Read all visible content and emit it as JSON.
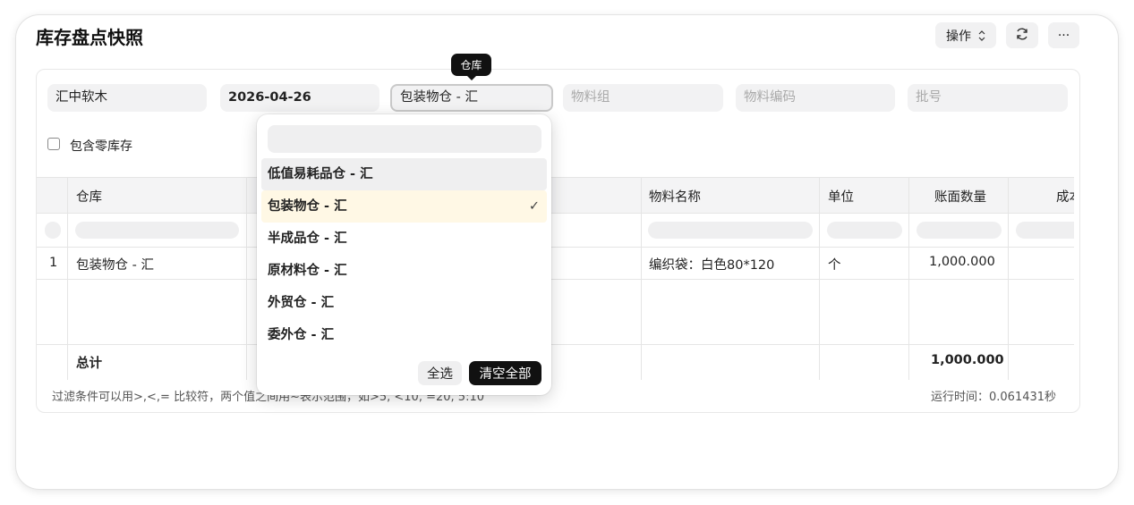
{
  "page": {
    "title": "库存盘点快照"
  },
  "toolbar": {
    "actions_label": "操作",
    "actions_chevron": "⌃⌄",
    "refresh_icon": "refresh-icon",
    "more_label": "···"
  },
  "filters": {
    "company": "汇中软木",
    "date": "2026-04-26",
    "warehouse": "包装物仓 - 汇",
    "item_group_placeholder": "物料组",
    "item_code_placeholder": "物料编码",
    "batch_placeholder": "批号",
    "include_zero_label": "包含零库存"
  },
  "tooltip": {
    "text": "仓库"
  },
  "dropdown": {
    "options": [
      {
        "label": "低值易耗品仓 - 汇",
        "state": "hover"
      },
      {
        "label": "包装物仓 - 汇",
        "state": "selected"
      },
      {
        "label": "半成品仓 - 汇",
        "state": ""
      },
      {
        "label": "原材料仓 - 汇",
        "state": ""
      },
      {
        "label": "外贸仓 - 汇",
        "state": ""
      },
      {
        "label": "委外仓 - 汇",
        "state": ""
      }
    ],
    "check_mark": "✓",
    "select_all_label": "全选",
    "clear_all_label": "清空全部"
  },
  "table": {
    "columns": [
      "仓库",
      "物料名称",
      "单位",
      "账面数量",
      "成本"
    ],
    "rows": [
      {
        "index": "1",
        "warehouse": "包装物仓 - 汇",
        "item_name": "编织袋：白色80*120",
        "unit": "个",
        "qty": "1,000.000"
      }
    ],
    "total_label": "总计",
    "total_qty": "1,000.000"
  },
  "footer": {
    "note": "过滤条件可以用>,<,= 比较符，两个值之间用~表示范围，如>5, <10, =20, 5:10",
    "runtime": "运行时间：0.061431秒"
  }
}
